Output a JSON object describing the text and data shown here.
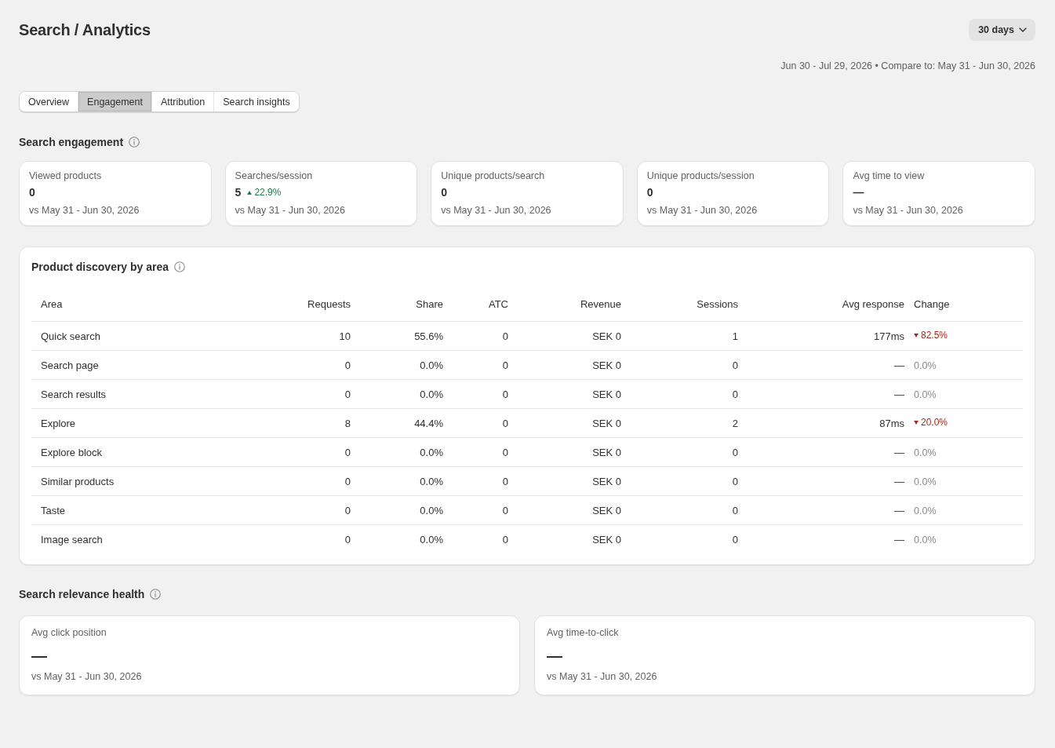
{
  "header": {
    "title": "Search / Analytics",
    "period_button": "30 days",
    "date_range": "Jun 30 - Jul 29, 2026 • Compare to: May 31 - Jun 30, 2026"
  },
  "tabs": [
    {
      "label": "Overview",
      "selected": false
    },
    {
      "label": "Engagement",
      "selected": true
    },
    {
      "label": "Attribution",
      "selected": false
    },
    {
      "label": "Search insights",
      "selected": false
    }
  ],
  "search_engagement": {
    "title": "Search engagement",
    "cards": [
      {
        "label": "Viewed products",
        "value": "0",
        "comparison": "vs May 31 - Jun 30, 2026"
      },
      {
        "label": "Searches/session",
        "value": "5",
        "change": {
          "text": "22.9%",
          "kind": "up"
        },
        "comparison": "vs May 31 - Jun 30, 2026"
      },
      {
        "label": "Unique products/search",
        "value": "0",
        "comparison": "vs May 31 - Jun 30, 2026"
      },
      {
        "label": "Unique products/session",
        "value": "0",
        "comparison": "vs May 31 - Jun 30, 2026"
      },
      {
        "label": "Avg time to view",
        "value": "—",
        "comparison": "vs May 31 - Jun 30, 2026"
      }
    ]
  },
  "product_discovery": {
    "title": "Product discovery by area",
    "columns": [
      {
        "label": "Area",
        "kind": "text"
      },
      {
        "label": "Requests",
        "kind": "number"
      },
      {
        "label": "Share",
        "kind": "number"
      },
      {
        "label": "ATC",
        "kind": "number"
      },
      {
        "label": "Revenue",
        "kind": "number"
      },
      {
        "label": "Sessions",
        "kind": "number"
      },
      {
        "label": "Avg response",
        "kind": "number"
      },
      {
        "label": "Change",
        "kind": "change"
      }
    ],
    "rows": [
      {
        "cells": [
          "Quick search",
          "10",
          "55.6%",
          "0",
          "SEK 0",
          "1",
          "177ms"
        ],
        "change": {
          "text": "82.5%",
          "kind": "down"
        }
      },
      {
        "cells": [
          "Search page",
          "0",
          "0.0%",
          "0",
          "SEK 0",
          "0",
          "—"
        ],
        "change": {
          "text": "0.0%",
          "kind": "flat"
        }
      },
      {
        "cells": [
          "Search results",
          "0",
          "0.0%",
          "0",
          "SEK 0",
          "0",
          "—"
        ],
        "change": {
          "text": "0.0%",
          "kind": "flat"
        }
      },
      {
        "cells": [
          "Explore",
          "8",
          "44.4%",
          "0",
          "SEK 0",
          "2",
          "87ms"
        ],
        "change": {
          "text": "20.0%",
          "kind": "down"
        }
      },
      {
        "cells": [
          "Explore block",
          "0",
          "0.0%",
          "0",
          "SEK 0",
          "0",
          "—"
        ],
        "change": {
          "text": "0.0%",
          "kind": "flat"
        }
      },
      {
        "cells": [
          "Similar products",
          "0",
          "0.0%",
          "0",
          "SEK 0",
          "0",
          "—"
        ],
        "change": {
          "text": "0.0%",
          "kind": "flat"
        }
      },
      {
        "cells": [
          "Taste",
          "0",
          "0.0%",
          "0",
          "SEK 0",
          "0",
          "—"
        ],
        "change": {
          "text": "0.0%",
          "kind": "flat"
        }
      },
      {
        "cells": [
          "Image search",
          "0",
          "0.0%",
          "0",
          "SEK 0",
          "0",
          "—"
        ],
        "change": {
          "text": "0.0%",
          "kind": "flat"
        }
      }
    ]
  },
  "relevance_health": {
    "title": "Search relevance health",
    "cards": [
      {
        "label": "Avg click position",
        "value": "—",
        "comparison": "vs May 31 - Jun 30, 2026"
      },
      {
        "label": "Avg time-to-click",
        "value": "—",
        "comparison": "vs May 31 - Jun 30, 2026"
      }
    ]
  }
}
